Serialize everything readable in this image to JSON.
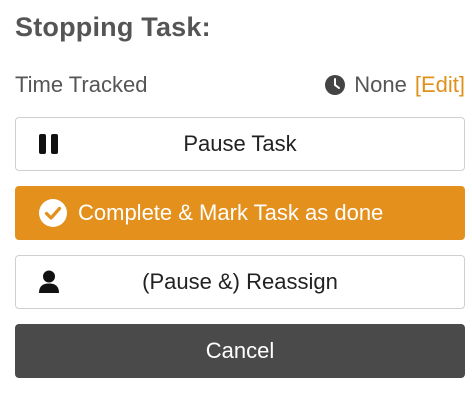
{
  "header": {
    "title": "Stopping Task:"
  },
  "time_tracked": {
    "label": "Time Tracked",
    "icon": "clock-icon",
    "value": "None",
    "edit_label": "[Edit]"
  },
  "actions": {
    "pause": {
      "label": "Pause Task",
      "icon": "pause-icon"
    },
    "complete": {
      "label": "Complete & Mark Task as done",
      "icon": "check-circle-icon"
    },
    "reassign": {
      "label": "(Pause &) Reassign",
      "icon": "user-icon"
    },
    "cancel": {
      "label": "Cancel"
    }
  },
  "colors": {
    "accent": "#e3901c",
    "cancel_bg": "#4a4a4a",
    "text": "#555555"
  }
}
